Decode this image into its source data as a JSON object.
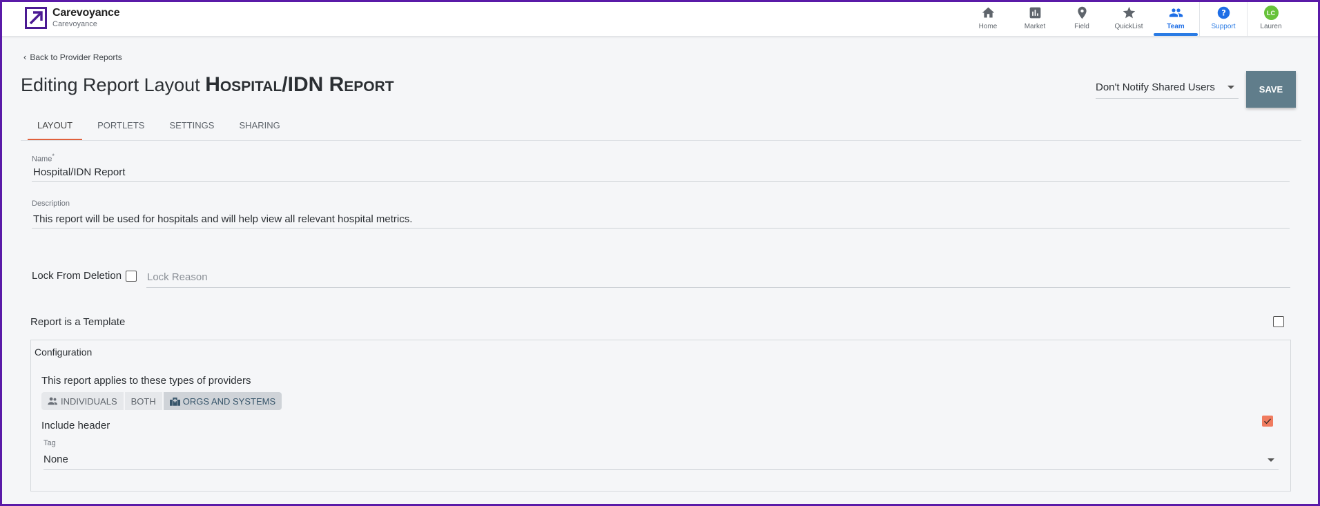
{
  "brand": {
    "name": "Carevoyance",
    "subtitle": "Carevoyance"
  },
  "nav": {
    "home": "Home",
    "market": "Market",
    "field": "Field",
    "quicklist": "QuickList",
    "team": "Team",
    "support": "Support",
    "user_initials": "LC",
    "user_name": "Lauren"
  },
  "header": {
    "back_link": "Back to Provider Reports",
    "title_prefix": "Editing Report Layout",
    "report_name": "Hospital/IDN Report",
    "notify_select": "Don't Notify Shared Users",
    "save_label": "SAVE"
  },
  "tabs": [
    {
      "label": "LAYOUT",
      "active": true
    },
    {
      "label": "PORTLETS",
      "active": false
    },
    {
      "label": "SETTINGS",
      "active": false
    },
    {
      "label": "SHARING",
      "active": false
    }
  ],
  "form": {
    "name_label": "Name",
    "name_required_mark": "*",
    "name_value": "Hospital/IDN Report",
    "description_label": "Description",
    "description_value": "This report will be used for hospitals and will help view all relevant hospital metrics.",
    "lock_label": "Lock From Deletion",
    "lock_checked": false,
    "lock_reason_placeholder": "Lock Reason",
    "template_label": "Report is a Template",
    "template_checked": false
  },
  "configuration": {
    "title": "Configuration",
    "applies_text": "This report applies to these types of providers",
    "provider_types": [
      {
        "label": "INDIVIDUALS",
        "selected": false
      },
      {
        "label": "BOTH",
        "selected": false
      },
      {
        "label": "ORGS AND SYSTEMS",
        "selected": true
      }
    ],
    "include_header_label": "Include header",
    "include_header_checked": true,
    "tag_label": "Tag",
    "tag_value": "None"
  },
  "colors": {
    "accent": "#e0603c",
    "active_nav": "#2a7be4",
    "save_button": "#607d8b",
    "frame": "#5a1aa8",
    "avatar": "#67c23a"
  }
}
